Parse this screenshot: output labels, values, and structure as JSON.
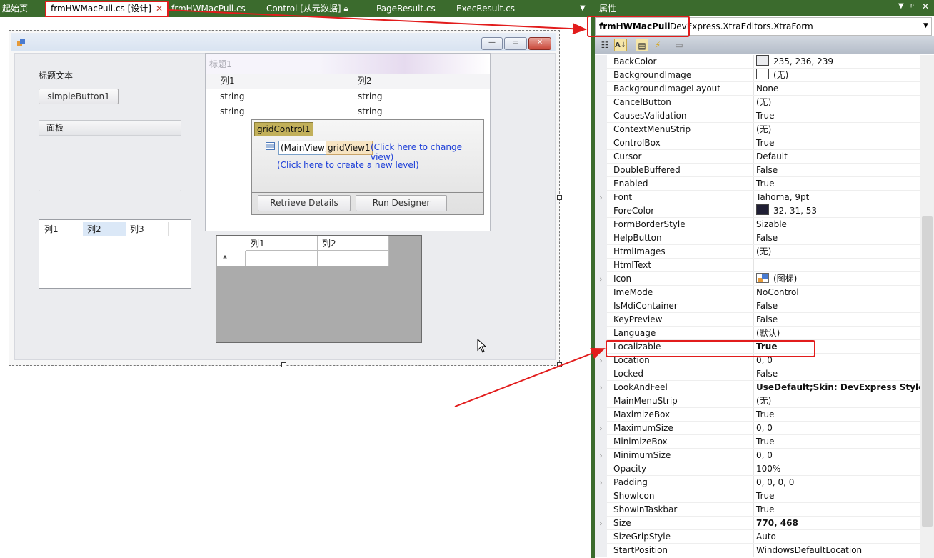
{
  "tabs": [
    {
      "label": "起始页"
    },
    {
      "label": "frmHWMacPull.cs [设计]",
      "active": true
    },
    {
      "label": "frmHWMacPull.cs"
    },
    {
      "label": "Control [从元数据]"
    },
    {
      "label": "PageResult.cs"
    },
    {
      "label": "ExecResult.cs"
    }
  ],
  "form": {
    "label_text": "标题文本",
    "simple_button": "simpleButton1",
    "panel_caption": "面板",
    "groupbox_caption": "标题1",
    "list_columns": [
      "列1",
      "列2",
      "列3"
    ],
    "grid1": {
      "columns": [
        "列1",
        "列2"
      ],
      "rows": [
        [
          "string",
          "string"
        ],
        [
          "string",
          "string"
        ]
      ]
    },
    "grid_popup": {
      "control_name": "gridControl1",
      "main_view": "(MainView)",
      "view_name": "gridView1",
      "change_view_link": "(Click here to change view)",
      "new_level_link": "(Click here to create a new level)",
      "retrieve_button": "Retrieve Details",
      "designer_button": "Run Designer"
    },
    "datagrid": {
      "columns": [
        "列1",
        "列2"
      ],
      "new_row_marker": "*"
    }
  },
  "properties": {
    "title": "属性",
    "object_name": "frmHWMacPull",
    "object_type": "DevExpress.XtraEditors.XtraForm",
    "rows": [
      {
        "name": "BackColor",
        "value": "235, 236, 239",
        "swatch": "#ebecef"
      },
      {
        "name": "BackgroundImage",
        "value": "(无)",
        "swatch": "#ffffff"
      },
      {
        "name": "BackgroundImageLayout",
        "value": "None"
      },
      {
        "name": "CancelButton",
        "value": "(无)"
      },
      {
        "name": "CausesValidation",
        "value": "True"
      },
      {
        "name": "ContextMenuStrip",
        "value": "(无)"
      },
      {
        "name": "ControlBox",
        "value": "True"
      },
      {
        "name": "Cursor",
        "value": "Default"
      },
      {
        "name": "DoubleBuffered",
        "value": "False"
      },
      {
        "name": "Enabled",
        "value": "True"
      },
      {
        "name": "Font",
        "value": "Tahoma, 9pt",
        "expand": true
      },
      {
        "name": "ForeColor",
        "value": "32, 31, 53",
        "swatch": "#201f35"
      },
      {
        "name": "FormBorderStyle",
        "value": "Sizable"
      },
      {
        "name": "HelpButton",
        "value": "False"
      },
      {
        "name": "HtmlImages",
        "value": "(无)"
      },
      {
        "name": "HtmlText",
        "value": ""
      },
      {
        "name": "Icon",
        "value": "(图标)",
        "expand": true,
        "icon": true
      },
      {
        "name": "ImeMode",
        "value": "NoControl"
      },
      {
        "name": "IsMdiContainer",
        "value": "False"
      },
      {
        "name": "KeyPreview",
        "value": "False"
      },
      {
        "name": "Language",
        "value": "(默认)"
      },
      {
        "name": "Localizable",
        "value": "True",
        "bold": true
      },
      {
        "name": "Location",
        "value": "0, 0",
        "expand": true
      },
      {
        "name": "Locked",
        "value": "False"
      },
      {
        "name": "LookAndFeel",
        "value": "UseDefault;Skin: DevExpress Style",
        "expand": true,
        "bold": true
      },
      {
        "name": "MainMenuStrip",
        "value": "(无)"
      },
      {
        "name": "MaximizeBox",
        "value": "True"
      },
      {
        "name": "MaximumSize",
        "value": "0, 0",
        "expand": true
      },
      {
        "name": "MinimizeBox",
        "value": "True"
      },
      {
        "name": "MinimumSize",
        "value": "0, 0",
        "expand": true
      },
      {
        "name": "Opacity",
        "value": "100%"
      },
      {
        "name": "Padding",
        "value": "0, 0, 0, 0",
        "expand": true
      },
      {
        "name": "ShowIcon",
        "value": "True"
      },
      {
        "name": "ShowInTaskbar",
        "value": "True"
      },
      {
        "name": "Size",
        "value": "770, 468",
        "expand": true,
        "bold": true
      },
      {
        "name": "SizeGripStyle",
        "value": "Auto"
      },
      {
        "name": "StartPosition",
        "value": "WindowsDefaultLocation"
      }
    ]
  },
  "colors": {
    "accent_green": "#3b6b2d",
    "highlight_red": "#e21c1c",
    "link_blue": "#1c3ed8"
  }
}
